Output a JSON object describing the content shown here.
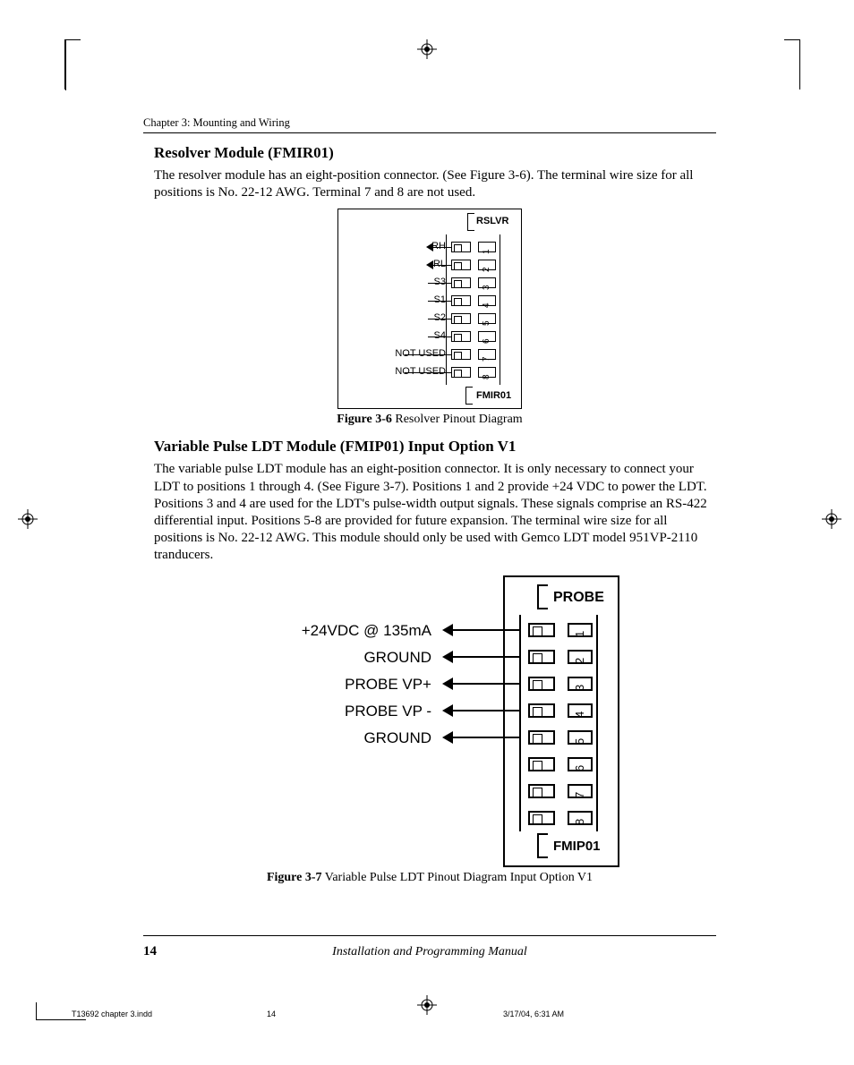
{
  "chapterLine": "Chapter 3:  Mounting and Wiring",
  "section1": {
    "title": "Resolver Module (FMIR01)",
    "para": "The resolver module has an eight-position connector.  (See Figure 3-6).  The terminal wire size for all positions is No. 22-12 AWG.  Terminal 7 and 8 are not used."
  },
  "fig1": {
    "topLabel": "RSLVR",
    "bottomLabel": "FMIR01",
    "pins": [
      {
        "label": "RH",
        "n": "1",
        "arrow": true
      },
      {
        "label": "RL",
        "n": "2",
        "arrow": true
      },
      {
        "label": "S3",
        "n": "3",
        "arrow": false
      },
      {
        "label": "S1",
        "n": "4",
        "arrow": false
      },
      {
        "label": "S2",
        "n": "5",
        "arrow": false
      },
      {
        "label": "S4",
        "n": "6",
        "arrow": false
      },
      {
        "label": "NOT USED",
        "n": "7",
        "arrow": false
      },
      {
        "label": "NOT USED",
        "n": "8",
        "arrow": false
      }
    ],
    "captionBold": "Figure 3-6",
    "captionRest": "  Resolver Pinout Diagram"
  },
  "section2": {
    "title": "Variable Pulse LDT Module (FMIP01) Input Option V1",
    "para": "The variable pulse LDT module has an eight-position connector.  It is only necessary to connect your LDT to positions 1 through 4.  (See Figure 3-7).  Positions 1 and 2 provide +24 VDC to power the LDT.  Positions 3 and 4 are used for the LDT's pulse-width output signals.  These signals comprise an RS-422 differential input.  Positions 5-8 are provided for future expansion.  The terminal wire size for all positions is No. 22-12 AWG. This module should only be used with Gemco LDT model 951VP-2110 tranducers."
  },
  "fig2": {
    "topLabel": "PROBE",
    "bottomLabel": "FMIP01",
    "pins": [
      {
        "label": "+24VDC @ 135mA",
        "n": "1",
        "wired": true
      },
      {
        "label": "GROUND",
        "n": "2",
        "wired": true
      },
      {
        "label": "PROBE VP+",
        "n": "3",
        "wired": true
      },
      {
        "label": "PROBE VP -",
        "n": "4",
        "wired": true
      },
      {
        "label": "GROUND",
        "n": "5",
        "wired": true
      },
      {
        "label": "",
        "n": "6",
        "wired": false
      },
      {
        "label": "",
        "n": "7",
        "wired": false
      },
      {
        "label": "",
        "n": "8",
        "wired": false
      }
    ],
    "captionBold": "Figure 3-7",
    "captionRest": "  Variable Pulse LDT Pinout Diagram Input Option V1"
  },
  "pageNumber": "14",
  "footerTitle": "Installation and Programming Manual",
  "slug": {
    "file": "T13692 chapter 3.indd",
    "page": "14",
    "timestamp": "3/17/04, 6:31 AM"
  }
}
